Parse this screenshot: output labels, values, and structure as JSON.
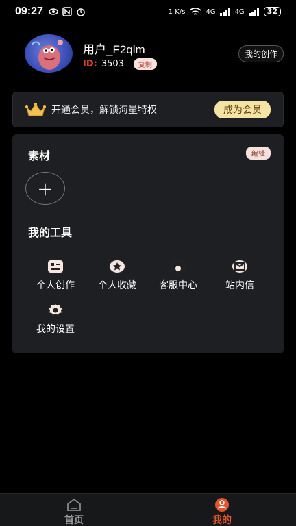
{
  "status": {
    "time": "09:27",
    "net_speed": "1 K/s",
    "signal": "4G",
    "battery": "32"
  },
  "profile": {
    "username": "用户_F2qlm",
    "id_label": "ID:",
    "id_value": "3503",
    "copy_label": "复制",
    "my_creation_label": "我的创作"
  },
  "vip": {
    "text": "开通会员，解锁海量特权",
    "button": "成为会员"
  },
  "materials": {
    "title": "素材",
    "edit_label": "编辑",
    "add_symbol": "+"
  },
  "tools": {
    "title": "我的工具",
    "items": [
      {
        "label": "个人创作",
        "icon": "creation-icon"
      },
      {
        "label": "个人收藏",
        "icon": "favorite-icon"
      },
      {
        "label": "客服中心",
        "icon": "customer-service-icon"
      },
      {
        "label": "站内信",
        "icon": "message-icon"
      },
      {
        "label": "我的设置",
        "icon": "settings-icon"
      }
    ]
  },
  "tabbar": {
    "home": "首页",
    "mine": "我的"
  },
  "colors": {
    "accent": "#d9432a",
    "vip_button": "#f4e3a3",
    "panel": "#1e1f22"
  }
}
